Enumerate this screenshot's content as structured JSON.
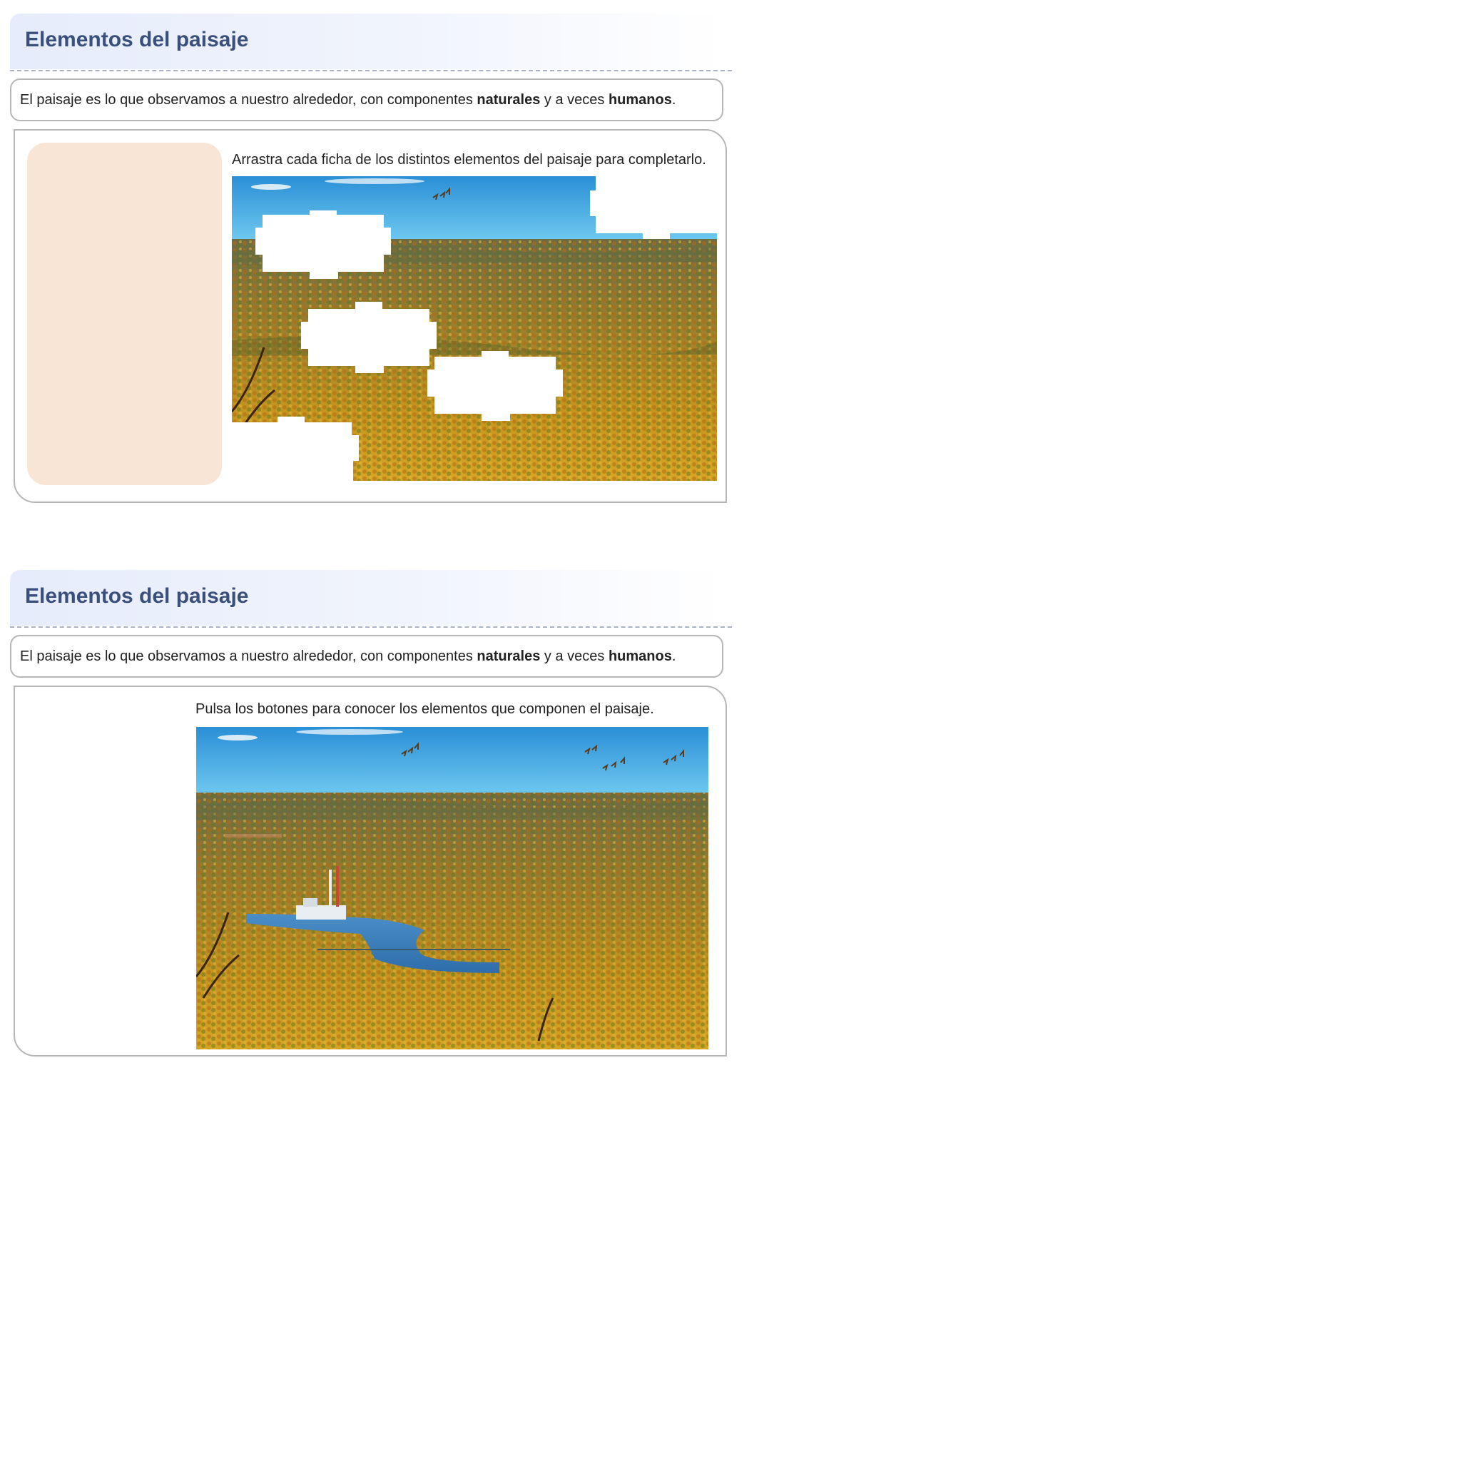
{
  "activity1": {
    "title": "Elementos del paisaje",
    "intro": {
      "before": "El paisaje es lo que observamos a nuestro alrededor, con componentes ",
      "bold1": "naturales",
      "middle": " y a veces ",
      "bold2": "humanos",
      "end": "."
    },
    "instruction": "Arrastra cada ficha de los distintos elementos del paisaje para completarlo.",
    "tray_color": "#f9e5d6"
  },
  "activity2": {
    "title": "Elementos del paisaje",
    "intro": {
      "before": "El paisaje es lo que observamos a nuestro alrededor, con componentes ",
      "bold1": "naturales",
      "middle": " y a veces ",
      "bold2": "humanos",
      "end": "."
    },
    "instruction": "Pulsa los botones para conocer los elementos que componen el paisaje."
  },
  "colors": {
    "title": "#3a4f7c",
    "border": "#b7b7b7",
    "sky": "#3fa9e6",
    "foliage": "#c98f1c"
  }
}
